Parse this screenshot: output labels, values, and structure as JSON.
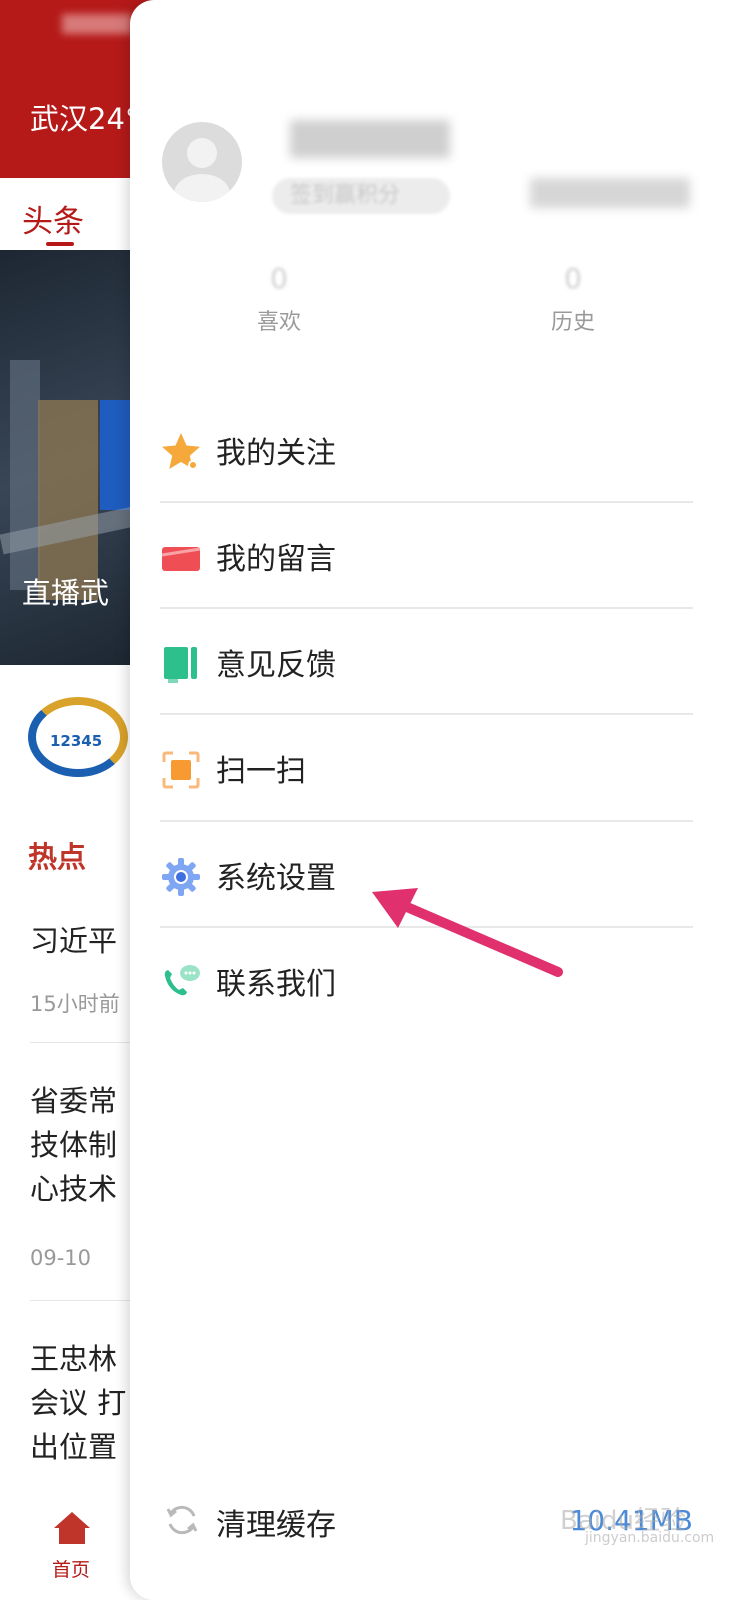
{
  "background_app": {
    "city_weather": "武汉24°",
    "active_tab": "头条",
    "banner_caption": "直播武",
    "section_hot": "热点",
    "logo_text": "12345",
    "feed": [
      {
        "title_lines": [
          "习近平"
        ],
        "meta": "15小时前"
      },
      {
        "title_lines": [
          "省委常",
          "技体制",
          "心技术"
        ],
        "meta": "09-10"
      },
      {
        "title_lines": [
          "王忠林",
          "会议 打",
          "出位置"
        ],
        "meta": ""
      }
    ],
    "bottom_nav_home": "首页"
  },
  "drawer": {
    "signin_badge": "签到赢积分",
    "stats": [
      {
        "count": "0",
        "label": "喜欢"
      },
      {
        "count": "0",
        "label": "历史"
      }
    ],
    "menu": [
      {
        "label": "我的关注",
        "icon": "star-icon",
        "color": "#f6a93b"
      },
      {
        "label": "我的留言",
        "icon": "message-card-icon",
        "color": "#ef4e55"
      },
      {
        "label": "意见反馈",
        "icon": "feedback-book-icon",
        "color": "#2dbf8c"
      },
      {
        "label": "扫一扫",
        "icon": "scan-icon",
        "color": "#f79a32"
      },
      {
        "label": "系统设置",
        "icon": "gear-icon",
        "color": "#5b8def"
      },
      {
        "label": "联系我们",
        "icon": "phone-chat-icon",
        "color": "#2dbf8c"
      }
    ],
    "clear_cache": {
      "label": "清理缓存",
      "size": "10.41MB",
      "icon": "refresh-icon"
    }
  },
  "watermark": {
    "text": "Baidu经验",
    "sub": "jingyan.baidu.com"
  },
  "colors": {
    "brand_red": "#b51a19",
    "annotation_arrow": "#e0306e",
    "cache_size_blue": "#4a8ad8"
  }
}
